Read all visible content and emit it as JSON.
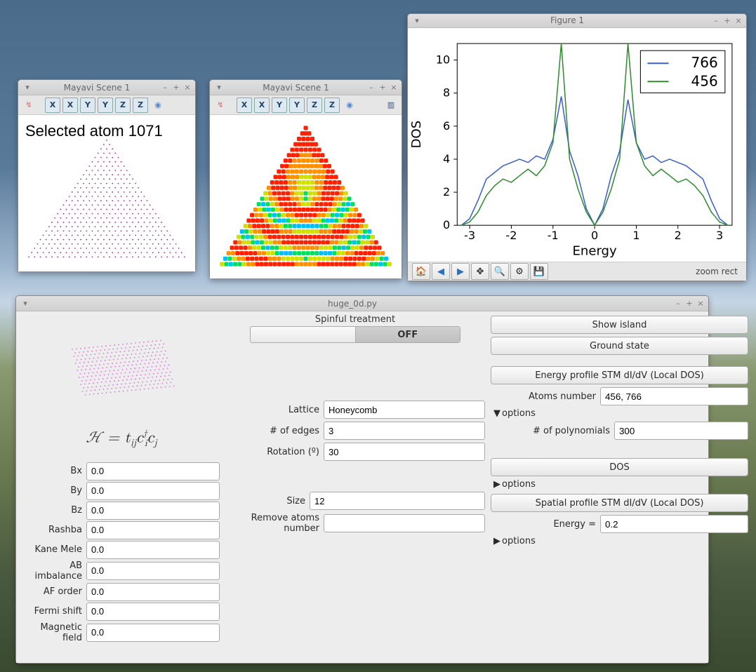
{
  "mayavi1": {
    "title": "Mayavi Scene 1",
    "axes": [
      "X",
      "X",
      "Y",
      "Y",
      "Z",
      "Z"
    ],
    "selected_label": "Selected atom 1071"
  },
  "mayavi2": {
    "title": "Mayavi Scene 1",
    "axes": [
      "X",
      "X",
      "Y",
      "Y",
      "Z",
      "Z"
    ]
  },
  "figure": {
    "title": "Figure 1",
    "status": "zoom rect",
    "nav_icons": [
      "home-icon",
      "back-icon",
      "forward-icon",
      "pan-icon",
      "zoom-icon",
      "config-icon",
      "save-icon"
    ]
  },
  "chart_data": {
    "type": "line",
    "title": "",
    "xlabel": "Energy",
    "ylabel": "DOS",
    "xlim": [
      -3.3,
      3.3
    ],
    "ylim": [
      0,
      11
    ],
    "xticks": [
      -3,
      -2,
      -1,
      0,
      1,
      2,
      3
    ],
    "yticks": [
      0,
      2,
      4,
      6,
      8,
      10
    ],
    "series": [
      {
        "name": "766",
        "color": "#3a5fcd",
        "x": [
          -3.2,
          -3.0,
          -2.8,
          -2.6,
          -2.4,
          -2.2,
          -2.0,
          -1.8,
          -1.6,
          -1.4,
          -1.2,
          -1.0,
          -0.8,
          -0.6,
          -0.4,
          -0.2,
          0.0,
          0.2,
          0.4,
          0.6,
          0.8,
          1.0,
          1.2,
          1.4,
          1.6,
          1.8,
          2.0,
          2.2,
          2.4,
          2.6,
          2.8,
          3.0,
          3.2
        ],
        "y": [
          0,
          0.4,
          1.5,
          2.8,
          3.2,
          3.6,
          3.8,
          4.0,
          3.8,
          4.2,
          4.0,
          5.2,
          7.8,
          4.5,
          3.0,
          1.0,
          0.0,
          1.0,
          3.0,
          4.5,
          7.6,
          5.0,
          4.0,
          4.2,
          3.8,
          4.0,
          3.8,
          3.6,
          3.2,
          2.8,
          1.5,
          0.4,
          0
        ]
      },
      {
        "name": "456",
        "color": "#2e8b2e",
        "x": [
          -3.2,
          -3.0,
          -2.8,
          -2.6,
          -2.4,
          -2.2,
          -2.0,
          -1.8,
          -1.6,
          -1.4,
          -1.2,
          -1.0,
          -0.8,
          -0.6,
          -0.4,
          -0.2,
          0.0,
          0.2,
          0.4,
          0.6,
          0.8,
          1.0,
          1.2,
          1.4,
          1.6,
          1.8,
          2.0,
          2.2,
          2.4,
          2.6,
          2.8,
          3.0,
          3.2
        ],
        "y": [
          0,
          0.2,
          0.8,
          1.8,
          2.4,
          2.8,
          2.6,
          3.0,
          3.4,
          3.0,
          3.6,
          5.0,
          11.0,
          4.0,
          2.2,
          0.8,
          0.0,
          0.8,
          2.2,
          4.0,
          11.0,
          5.0,
          3.6,
          3.0,
          3.4,
          3.0,
          2.6,
          2.8,
          2.4,
          1.8,
          0.8,
          0.2,
          0
        ]
      }
    ],
    "legend": [
      "766",
      "456"
    ]
  },
  "main": {
    "title": "huge_0d.py",
    "spinful_label": "Spinful treatment",
    "spinful_state": "OFF",
    "hamiltonian_text": "ℋ = t_{ij} c_i^† c_j",
    "left_fields": [
      {
        "label": "Bx",
        "value": "0.0"
      },
      {
        "label": "By",
        "value": "0.0"
      },
      {
        "label": "Bz",
        "value": "0.0"
      },
      {
        "label": "Rashba",
        "value": "0.0"
      },
      {
        "label": "Kane Mele",
        "value": "0.0"
      },
      {
        "label": "AB imbalance",
        "value": "0.0"
      },
      {
        "label": "AF order",
        "value": "0.0"
      },
      {
        "label": "Fermi shift",
        "value": "0.0"
      },
      {
        "label": "Magnetic field",
        "value": "0.0"
      }
    ],
    "lattice_label": "Lattice",
    "lattice_value": "Honeycomb",
    "edges_label": "# of edges",
    "edges_value": "3",
    "rotation_label": "Rotation (º)",
    "rotation_value": "30",
    "size_label": "Size",
    "size_value": "12",
    "remove_label": "Remove atoms number",
    "remove_value": "",
    "show_island": "Show island",
    "ground_state": "Ground state",
    "energy_profile_btn": "Energy profile STM dI/dV (Local DOS)",
    "atoms_number_label": "Atoms number",
    "atoms_number_value": "456, 766",
    "options_label": "options",
    "polynomials_label": "# of polynomials",
    "polynomials_value": "300",
    "dos_btn": "DOS",
    "spatial_btn": "Spatial profile STM dI/dV (Local DOS)",
    "energy_eq_label": "Energy =",
    "energy_eq_value": "0.2"
  }
}
